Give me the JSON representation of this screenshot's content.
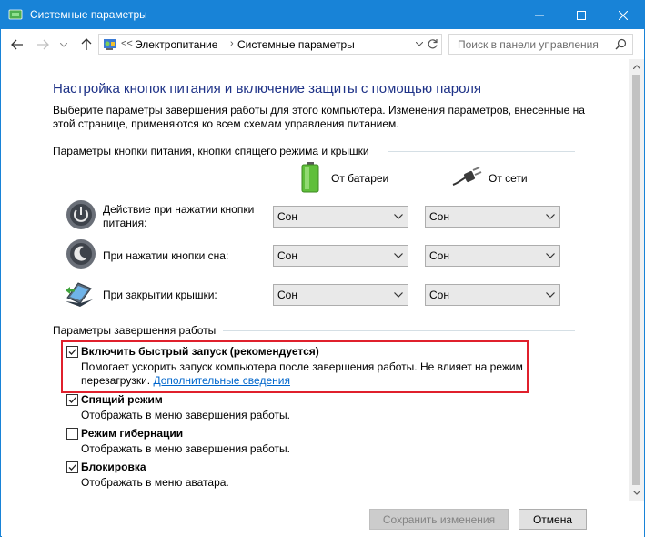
{
  "window": {
    "title": "Системные параметры"
  },
  "address": {
    "overflow": "<<",
    "crumbs": [
      "Электропитание",
      "Системные параметры"
    ],
    "search_placeholder": "Поиск в панели управления"
  },
  "page": {
    "heading": "Настройка кнопок питания и включение защиты с помощью пароля",
    "description": "Выберите параметры завершения работы для этого компьютера. Изменения параметров, внесенные на этой странице, применяются ко всем схемам управления питанием."
  },
  "power_buttons": {
    "group_title": "Параметры кнопки питания, кнопки спящего режима и крышки",
    "col_battery": "От батареи",
    "col_ac": "От сети",
    "rows": [
      {
        "label": "Действие при нажатии кнопки питания:",
        "battery": "Сон",
        "ac": "Сон",
        "icon": "power-button-icon"
      },
      {
        "label": "При нажатии кнопки сна:",
        "battery": "Сон",
        "ac": "Сон",
        "icon": "sleep-button-icon"
      },
      {
        "label": "При закрытии крышки:",
        "battery": "Сон",
        "ac": "Сон",
        "icon": "laptop-lid-icon"
      }
    ]
  },
  "shutdown": {
    "group_title": "Параметры завершения работы",
    "options": [
      {
        "label": "Включить быстрый запуск (рекомендуется)",
        "checked": true,
        "desc": "Помогает ускорить запуск компьютера после завершения работы. Не влияет на режим перезагрузки.",
        "link": "Дополнительные сведения"
      },
      {
        "label": "Спящий режим",
        "checked": true,
        "desc": "Отображать в меню завершения работы."
      },
      {
        "label": "Режим гибернации",
        "checked": false,
        "desc": "Отображать в меню завершения работы."
      },
      {
        "label": "Блокировка",
        "checked": true,
        "desc": "Отображать в меню аватара."
      }
    ]
  },
  "footer": {
    "save_label": "Сохранить изменения",
    "cancel_label": "Отмена"
  },
  "colors": {
    "titlebar": "#1883d7",
    "heading": "#1e3287",
    "highlight": "#e0202c",
    "link": "#0066cc"
  }
}
